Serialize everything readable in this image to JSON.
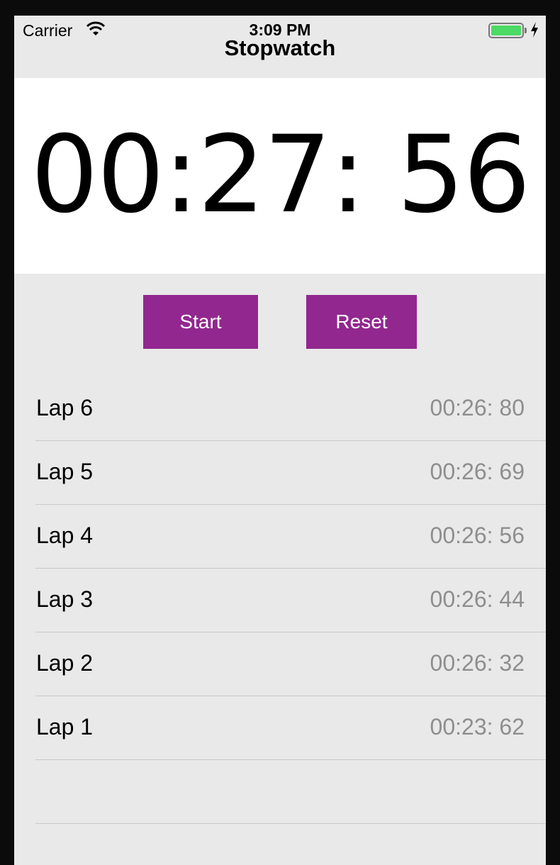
{
  "status_bar": {
    "carrier": "Carrier",
    "time": "3:09 PM",
    "battery_color": "#4cd964"
  },
  "nav": {
    "title": "Stopwatch"
  },
  "timer": {
    "display": "00:27: 56"
  },
  "buttons": {
    "start_label": "Start",
    "reset_label": "Reset",
    "accent_color": "#92278f"
  },
  "laps": [
    {
      "label": "Lap 6",
      "time": "00:26: 80"
    },
    {
      "label": "Lap 5",
      "time": "00:26: 69"
    },
    {
      "label": "Lap 4",
      "time": "00:26: 56"
    },
    {
      "label": "Lap 3",
      "time": "00:26: 44"
    },
    {
      "label": "Lap 2",
      "time": "00:26: 32"
    },
    {
      "label": "Lap 1",
      "time": "00:23: 62"
    }
  ]
}
